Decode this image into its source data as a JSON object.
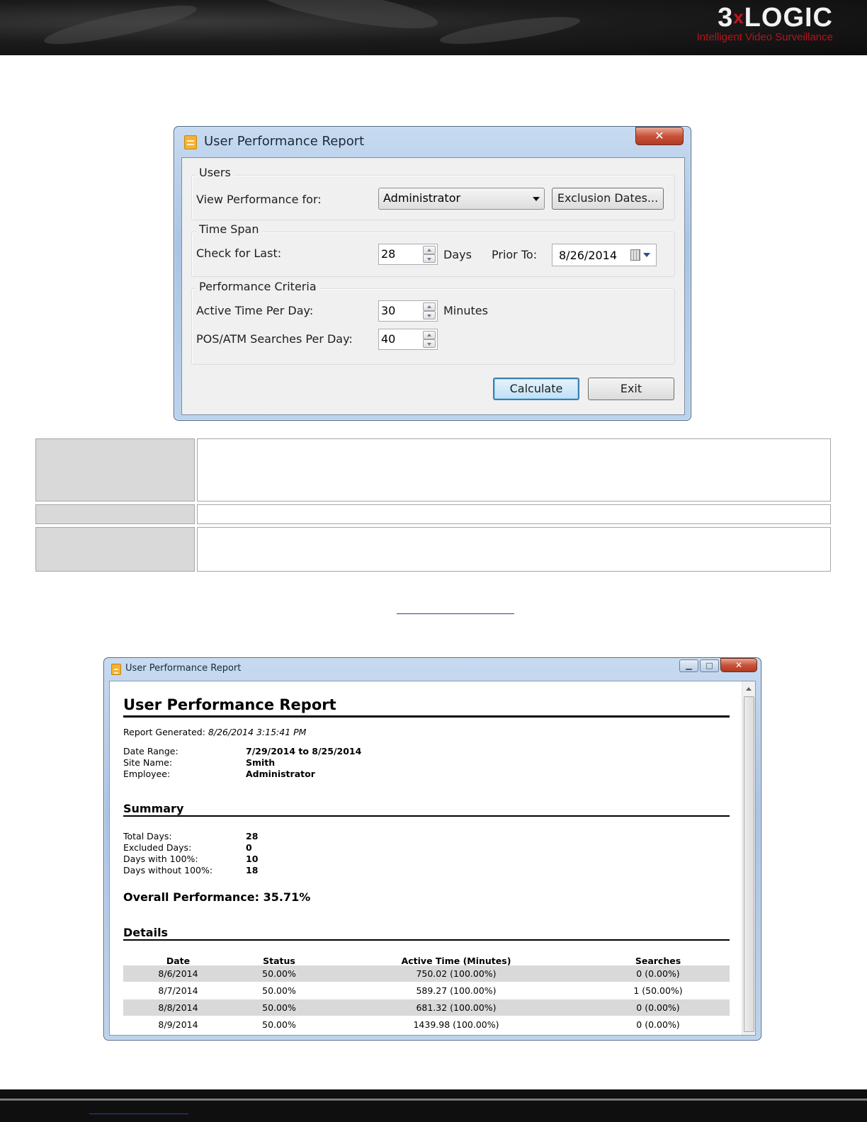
{
  "header": {
    "logo_text": "3xLOGIC",
    "logo_prefix": "3",
    "logo_x": "x",
    "logo_suffix": "LOGIC",
    "logo_tagline": "Intelligent Video Surveillance"
  },
  "dialog": {
    "title": "User Performance Report",
    "close_glyph": "✕",
    "users_group": "Users",
    "view_performance_label": "View Performance for:",
    "user_select_value": "Administrator",
    "exclusion_button": "Exclusion Dates...",
    "time_span_group": "Time Span",
    "check_for_last_label": "Check for Last:",
    "check_for_last_value": "28",
    "days_label": "Days",
    "prior_to_label": "Prior To:",
    "prior_to_value": "8/26/2014",
    "criteria_group": "Performance Criteria",
    "active_time_label": "Active Time Per Day:",
    "active_time_value": "30",
    "minutes_label": "Minutes",
    "pos_searches_label": "POS/ATM Searches Per Day:",
    "pos_searches_value": "40",
    "calculate_button": "Calculate",
    "exit_button": "Exit"
  },
  "report_window": {
    "title": "User Performance Report",
    "minimize_glyph": "▁",
    "maximize_glyph": "□",
    "close_glyph": "✕",
    "heading": "User Performance Report",
    "generated_label": "Report Generated:",
    "generated_value": "8/26/2014 3:15:41 PM",
    "date_range_label": "Date Range:",
    "date_range_value": "7/29/2014 to 8/25/2014",
    "site_name_label": "Site Name:",
    "site_name_value": "Smith",
    "employee_label": "Employee:",
    "employee_value": "Administrator",
    "summary_heading": "Summary",
    "total_days_label": "Total Days:",
    "total_days_value": "28",
    "excluded_days_label": "Excluded Days:",
    "excluded_days_value": "0",
    "days_with_label": "Days with 100%:",
    "days_with_value": "10",
    "days_without_label": "Days without 100%:",
    "days_without_value": "18",
    "overall_performance": "Overall Performance: 35.71%",
    "details_heading": "Details",
    "columns": [
      "Date",
      "Status",
      "Active Time (Minutes)",
      "Searches"
    ],
    "rows": [
      [
        "8/6/2014",
        "50.00%",
        "750.02 (100.00%)",
        "0 (0.00%)"
      ],
      [
        "8/7/2014",
        "50.00%",
        "589.27 (100.00%)",
        "1 (50.00%)"
      ],
      [
        "8/8/2014",
        "50.00%",
        "681.32 (100.00%)",
        "0 (0.00%)"
      ],
      [
        "8/9/2014",
        "50.00%",
        "1439.98 (100.00%)",
        "0 (0.00%)"
      ]
    ]
  }
}
